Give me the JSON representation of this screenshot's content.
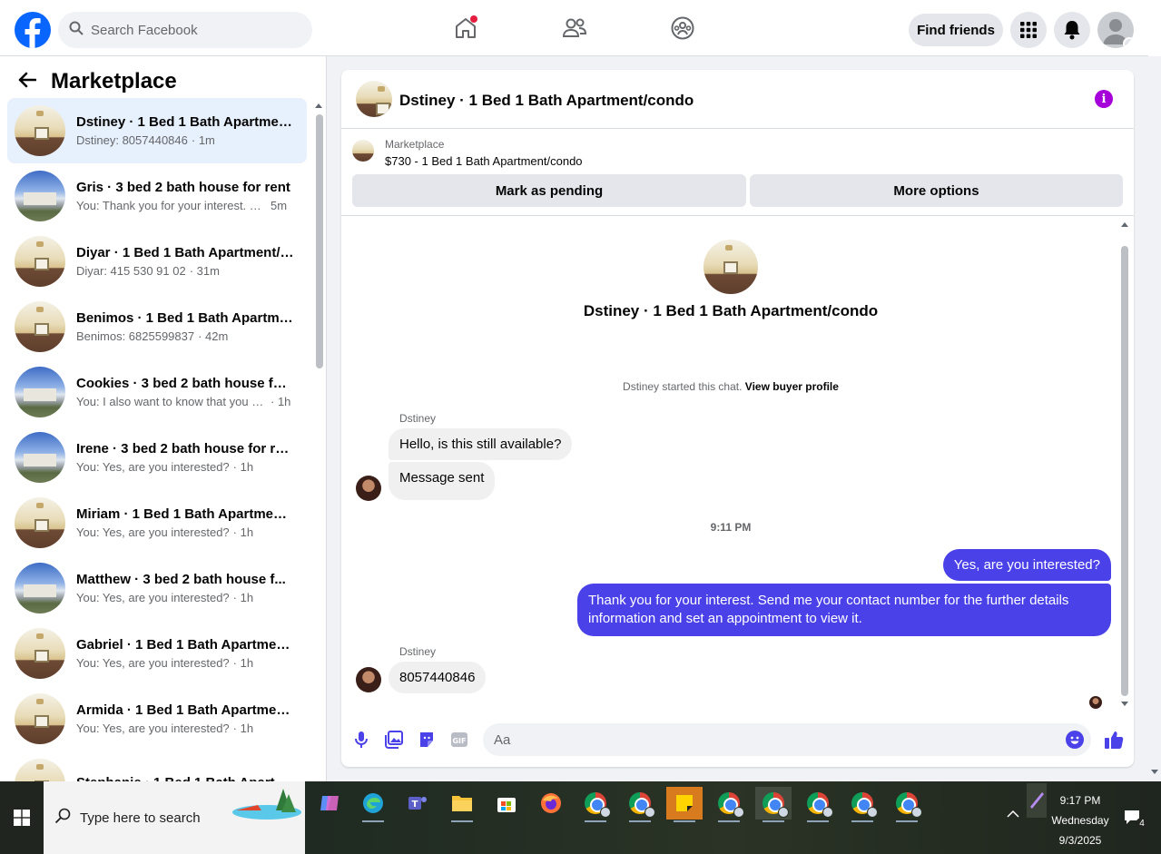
{
  "header": {
    "search_placeholder": "Search Facebook",
    "find_friends_label": "Find friends",
    "icons": [
      "facebook-logo",
      "search-icon",
      "home-icon",
      "friends-icon",
      "groups-icon",
      "menu-grid-icon",
      "bell-icon",
      "avatar"
    ]
  },
  "sidebar": {
    "title": "Marketplace",
    "conversations": [
      {
        "name": "Dstiney · 1 Bed 1 Bath Apartmen...",
        "snippet": "Dstiney: 8057440846",
        "time": "· 1m",
        "thumb": "apt",
        "active": true
      },
      {
        "name": "Gris · 3 bed 2 bath house for rent",
        "snippet": "You: Thank you for your interest. S...",
        "time": "5m",
        "thumb": "house",
        "active": false
      },
      {
        "name": "Diyar · 1 Bed 1 Bath Apartment/c...",
        "snippet": "Diyar: 415 530 91 02",
        "time": "· 31m",
        "thumb": "apt",
        "active": false
      },
      {
        "name": "Benimos · 1 Bed 1 Bath Apartme...",
        "snippet": "Benimos: 6825599837",
        "time": "· 42m",
        "thumb": "apt",
        "active": false
      },
      {
        "name": "Cookies · 3 bed 2 bath house for...",
        "snippet": "You: I also want to know that you h...",
        "time": "· 1h",
        "thumb": "house",
        "active": false
      },
      {
        "name": "Irene · 3 bed 2 bath house for rent",
        "snippet": "You: Yes, are you interested?",
        "time": "· 1h",
        "thumb": "house",
        "active": false
      },
      {
        "name": "Miriam · 1 Bed 1 Bath Apartment...",
        "snippet": "You: Yes, are you interested?",
        "time": "· 1h",
        "thumb": "apt",
        "active": false
      },
      {
        "name": "Matthew · 3 bed 2 bath house f...",
        "snippet": "You: Yes, are you interested?",
        "time": "· 1h",
        "thumb": "house",
        "active": false
      },
      {
        "name": "Gabriel · 1 Bed 1 Bath Apartment...",
        "snippet": "You: Yes, are you interested?",
        "time": "· 1h",
        "thumb": "apt",
        "active": false
      },
      {
        "name": "Armida · 1 Bed 1 Bath Apartmen...",
        "snippet": "You: Yes, are you interested?",
        "time": "· 1h",
        "thumb": "apt",
        "active": false
      },
      {
        "name": "Stephanie · 1 Bed 1 Bath Apart...",
        "snippet": "",
        "time": "",
        "thumb": "apt",
        "active": false
      }
    ]
  },
  "chat": {
    "title": "Dstiney · 1 Bed 1 Bath Apartment/condo",
    "marketplace_label": "Marketplace",
    "listing": "$730 - 1 Bed 1 Bath Apartment/condo",
    "mark_pending_label": "Mark as pending",
    "more_options_label": "More options",
    "intro_title": "Dstiney · 1 Bed 1 Bath Apartment/condo",
    "started_text": "Dstiney started this chat.",
    "view_profile_label": "View buyer profile",
    "sender_name": "Dstiney",
    "msg1": "Hello, is this still available?",
    "msg2": "Message sent",
    "timestamp": "9:11 PM",
    "msg3": "Yes, are you interested?",
    "msg4": "Thank you for your interest. Send me your contact number for the further details information and set an appointment to view it.",
    "msg5": "8057440846",
    "composer_placeholder": "Aa",
    "accent_color": "#4a41e8",
    "icons": [
      "info-icon",
      "microphone-icon",
      "gallery-icon",
      "sticker-icon",
      "gif-icon",
      "emoji-icon",
      "thumbs-up-icon"
    ]
  },
  "taskbar": {
    "search_placeholder": "Type here to search",
    "time": "9:17 PM",
    "day": "Wednesday",
    "date": "9/3/2025",
    "notification_count": "4"
  }
}
